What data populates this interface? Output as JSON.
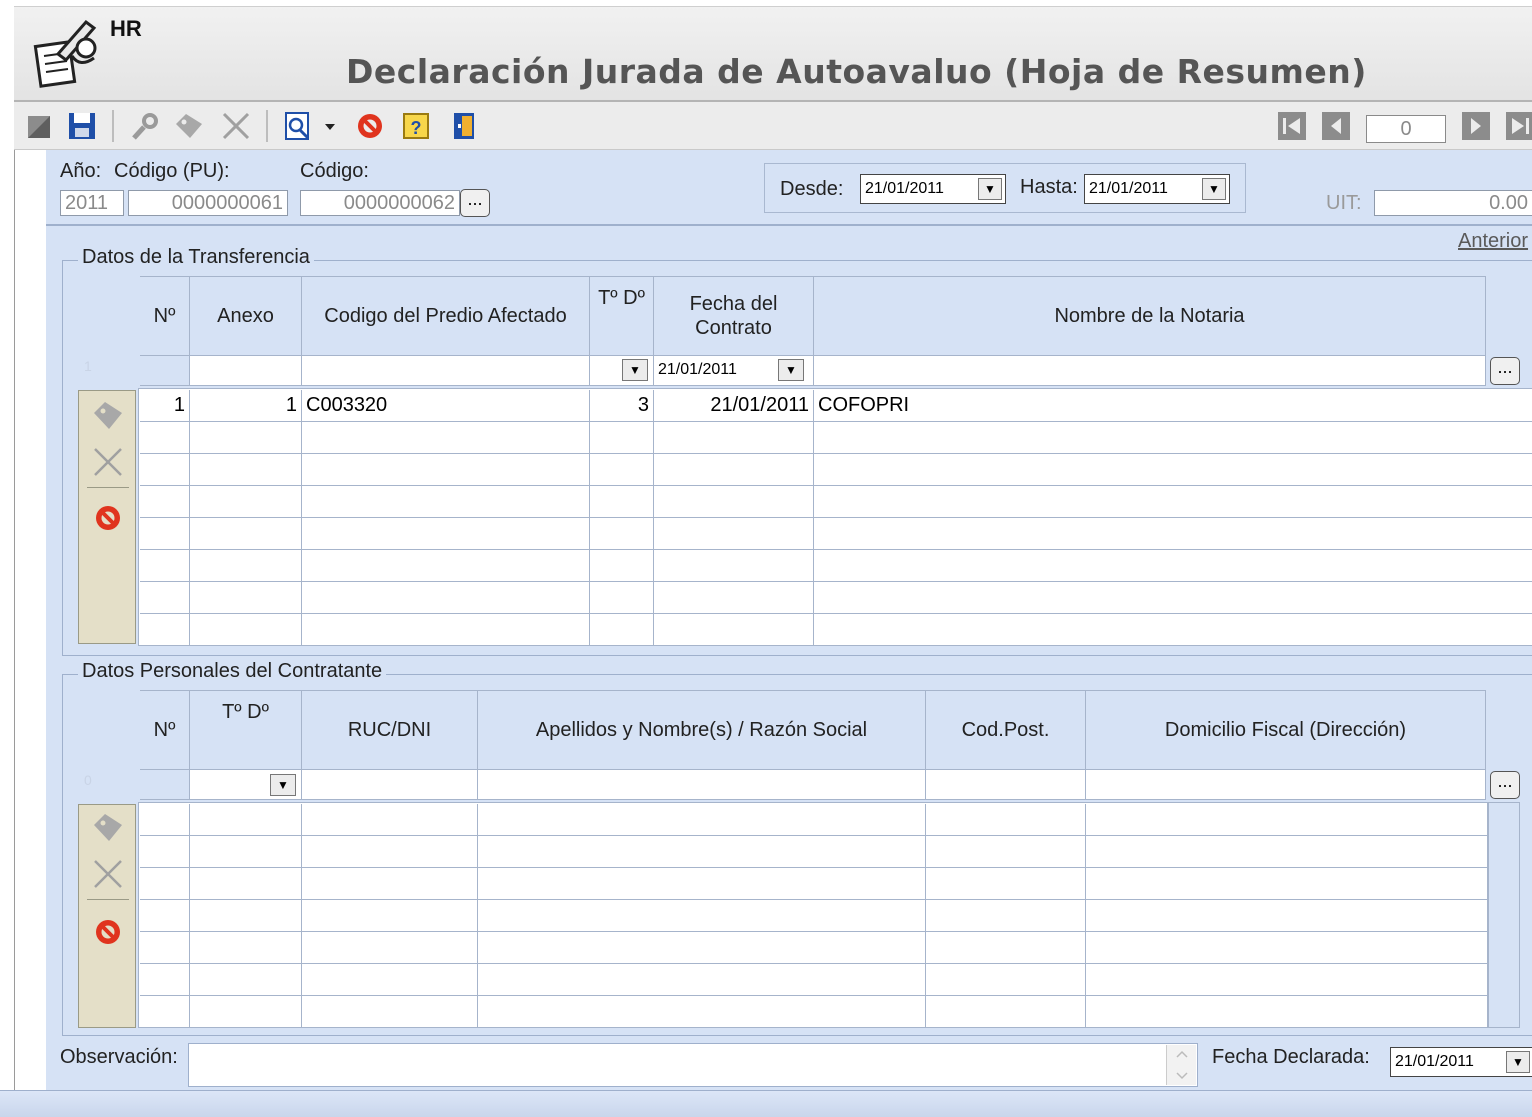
{
  "app": {
    "code": "HR",
    "title": "Declaración Jurada de Autoavaluo (Hoja de Resumen)"
  },
  "toolbar": {
    "buttons": [
      "new-icon",
      "save-icon",
      "search-icon",
      "edit-icon",
      "delete-icon",
      "preview-icon",
      "dropdown-icon",
      "cancel-icon",
      "help-icon",
      "exit-icon"
    ],
    "nav_counter": "0"
  },
  "form": {
    "anio_label": "Año:",
    "anio_value": "2011",
    "codigo_pu_label": "Código (PU):",
    "codigo_pu_value": "0000000061",
    "codigo_label": "Código:",
    "codigo_value": "0000000062",
    "ellipsis": "...",
    "desde_label": "Desde:",
    "desde_value": "21/01/2011",
    "hasta_label": "Hasta:",
    "hasta_value": "21/01/2011",
    "uit_label": "UIT:",
    "uit_value": "0.00",
    "anterior_link": "Anterior"
  },
  "transfer": {
    "title": "Datos de la Transferencia",
    "headers": [
      "Nº",
      "Anexo",
      "Codigo del Predio Afectado",
      "Tº Dº",
      "Fecha del Contrato",
      "Nombre de la Notaria"
    ],
    "filter_row_index": "1",
    "filter_date": "21/01/2011",
    "rows": [
      {
        "n": "1",
        "anexo": "1",
        "codigo": "C003320",
        "td": "3",
        "fecha": "21/01/2011",
        "notaria": "COFOPRI"
      }
    ]
  },
  "personal": {
    "title": "Datos Personales del Contratante",
    "headers": [
      "Nº",
      "Tº Dº",
      "RUC/DNI",
      "Apellidos y Nombre(s) / Razón Social",
      "Cod.Post.",
      "Domicilio Fiscal (Dirección)"
    ],
    "filter_row_index": "0"
  },
  "footer": {
    "observacion_label": "Observación:",
    "observacion_value": "",
    "fecha_declarada_label": "Fecha Declarada:",
    "fecha_declarada_value": "21/01/2011"
  },
  "colors": {
    "panel": "#d6e2f5",
    "grid_line": "#a6b4cb",
    "side_panel": "#e4dfc8",
    "toolbar_blue": "#1f4fa8",
    "stop_red": "#e0341e"
  }
}
